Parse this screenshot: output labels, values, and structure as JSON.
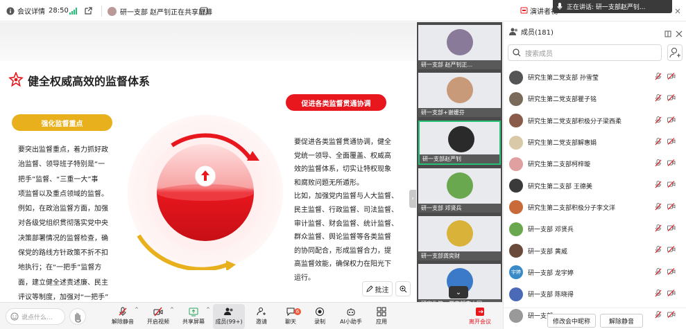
{
  "topbar": {
    "meeting_details": "会议详情",
    "timer": "28:50",
    "sharing_status": "研一支部 赵严钊正在共享屏幕",
    "presenter_label": "演讲者视",
    "speaking_label": "正在讲话: 研一支部赵严钊..."
  },
  "slide": {
    "title": "健全权威高效的监督体系",
    "left_pill": "强化监督重点",
    "right_pill": "促进各类监督贯通协调",
    "left_lines": [
      "要突出监督重点，着力抓好政",
      "治监督、领导班子特别是“一",
      "把手”监督、“三重一大”事",
      "项监督以及重点领域的监督。",
      "例如，在政治监督方面，加强",
      "对各级党组织贯彻落实党中央",
      "决策部署情况的监督检查，确",
      "保党的路线方针政策不折不扣",
      "地执行；在“一把手”监督方",
      "面，建立健全述责述廉、民主",
      "评议等制度，加强对“一把手”",
      "权力运行的制约和监督。"
    ],
    "right_lines": [
      "要促进各类监督贯通协调，健全",
      "党统一领导、全面覆盖、权威高",
      "效的监督体系，切实让特权现象",
      "和腐败问题无所遁形。",
      "比如，加强党内监督与人大监督、",
      "民主监督、行政监督、司法监督、",
      "审计监督、财会监督、统计监督、",
      "群众监督、舆论监督等各类监督",
      "的协同配合，形成监督合力，提",
      "高监督效能，确保权力在阳光下",
      "运行。"
    ],
    "annotate_label": "批注",
    "colors": {
      "red": "#e8161d",
      "gold": "#e8b01c"
    }
  },
  "videos": [
    {
      "name": "研一支部 赵严钊正...",
      "color": "#8a7a9a"
    },
    {
      "name": "研一支部+谢媛芬",
      "color": "#c89a7a"
    },
    {
      "name": "研一支部赵严钊",
      "color": "#2a2a2a"
    },
    {
      "name": "研一支部 邓贤兵",
      "color": "#6aa84f"
    },
    {
      "name": "研一支部龚奕财",
      "color": "#d9b23a"
    },
    {
      "name": "研究生第一党支部李大同",
      "color": "#3a7ac8"
    }
  ],
  "panel": {
    "title": "成员(181)",
    "search_placeholder": "搜索成员",
    "members": [
      {
        "name": "研究生第二党支部 孙雪莹",
        "color": "#555"
      },
      {
        "name": "研究生第二党支部瞿子铭",
        "color": "#7a6a5a"
      },
      {
        "name": "研究生第二党支部积极分子梁西柔",
        "color": "#8a5a4a"
      },
      {
        "name": "研究生第二党支部解惠娟",
        "color": "#d9c9a9"
      },
      {
        "name": "研究生第二支部柯梓璇",
        "color": "#e0a0a0"
      },
      {
        "name": "研究生第二支部 王德美",
        "color": "#3a3a3a"
      },
      {
        "name": "研究生第二支部积极分子李文洋",
        "color": "#c86a3a"
      },
      {
        "name": "研一支部 邓贤兵",
        "color": "#6aa84f"
      },
      {
        "name": "研一支部 黄威",
        "color": "#6a4a3a"
      },
      {
        "name": "研一支部 龙宇婷",
        "color": "#3a8ac8",
        "initials": "宇婷"
      },
      {
        "name": "研一支部 陈晓得",
        "color": "#4a6ab8"
      },
      {
        "name": "研一支部",
        "color": "#999"
      }
    ],
    "rename_label": "修改会中昵称",
    "unmute_label": "解除静音"
  },
  "toolbar": {
    "say_placeholder": "说点什么...",
    "items": [
      "解除静音",
      "开启视频",
      "共享屏幕",
      "成员(99+)",
      "邀请",
      "聊天",
      "录制",
      "AI小助手",
      "应用",
      "离开会议"
    ],
    "chat_badge": "6"
  }
}
